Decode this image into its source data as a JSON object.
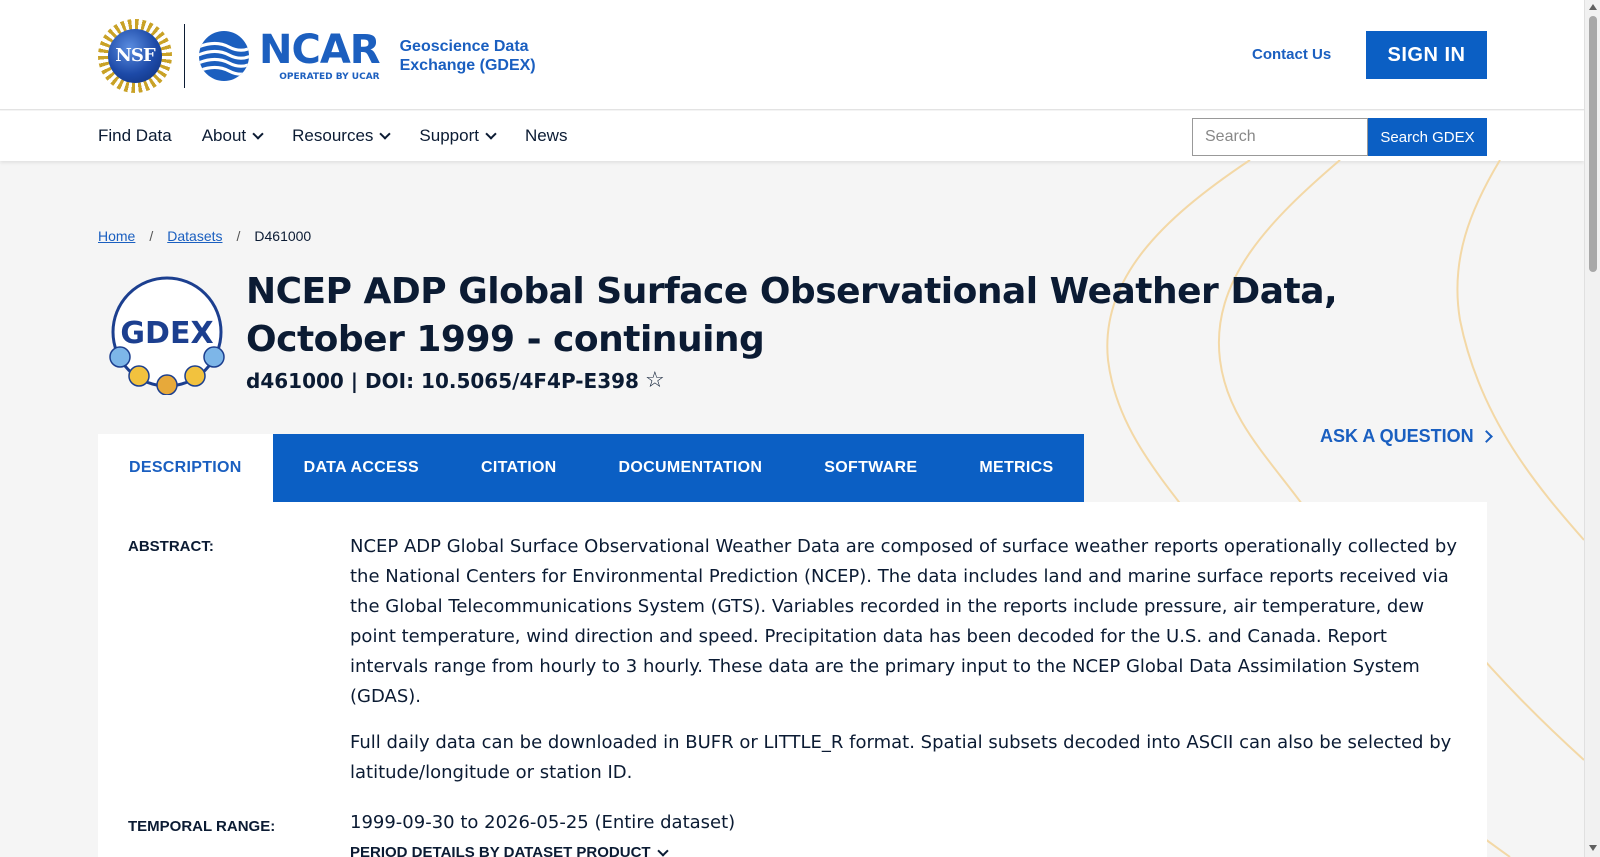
{
  "header": {
    "nsf_logo_text": "NSF",
    "ncar_logo_text": "NCAR",
    "ncar_subtext": "OPERATED BY UCAR",
    "site_title_line1": "Geoscience Data",
    "site_title_line2": "Exchange (GDEX)",
    "contact_label": "Contact Us",
    "signin_label": "SIGN IN"
  },
  "nav": {
    "items": [
      {
        "label": "Find Data",
        "has_dropdown": false
      },
      {
        "label": "About",
        "has_dropdown": true
      },
      {
        "label": "Resources",
        "has_dropdown": true
      },
      {
        "label": "Support",
        "has_dropdown": true
      },
      {
        "label": "News",
        "has_dropdown": false
      }
    ],
    "search_placeholder": "Search",
    "search_button": "Search GDEX"
  },
  "breadcrumb": {
    "home": "Home",
    "datasets": "Datasets",
    "current": "D461000",
    "separator": "/"
  },
  "dataset": {
    "badge_text": "GDEX",
    "title": "NCEP ADP Global Surface Observational Weather Data, October 1999 - continuing",
    "doi_line": "d461000 | DOI: 10.5065/4F4P-E398",
    "star_icon": "☆"
  },
  "ask_question": "ASK A QUESTION",
  "tabs": [
    {
      "label": "DESCRIPTION",
      "active": true
    },
    {
      "label": "DATA ACCESS",
      "active": false
    },
    {
      "label": "CITATION",
      "active": false
    },
    {
      "label": "DOCUMENTATION",
      "active": false
    },
    {
      "label": "SOFTWARE",
      "active": false
    },
    {
      "label": "METRICS",
      "active": false
    }
  ],
  "description": {
    "abstract_label": "ABSTRACT:",
    "abstract_p1": "NCEP ADP Global Surface Observational Weather Data are composed of surface weather reports operationally collected by the National Centers for Environmental Prediction (NCEP). The data includes land and marine surface reports received via the Global Telecommunications System (GTS). Variables recorded in the reports include pressure, air temperature, dew point temperature, wind direction and speed. Precipitation data has been decoded for the U.S. and Canada. Report intervals range from hourly to 3 hourly. These data are the primary input to the NCEP Global Data Assimilation System (GDAS).",
    "abstract_p2": "Full daily data can be downloaded in BUFR or LITTLE_R format. Spatial subsets decoded into ASCII can also be selected by latitude/longitude or station ID.",
    "temporal_label": "TEMPORAL RANGE:",
    "temporal_value": "1999-09-30 to 2026-05-25 (Entire dataset)",
    "period_details": "PERIOD DETAILS BY DATASET PRODUCT"
  },
  "colors": {
    "primary_blue": "#0b5fc4",
    "link_blue": "#1a5fc0",
    "text_dark": "#0b1b33",
    "curve_tan": "#f3d8a6"
  }
}
